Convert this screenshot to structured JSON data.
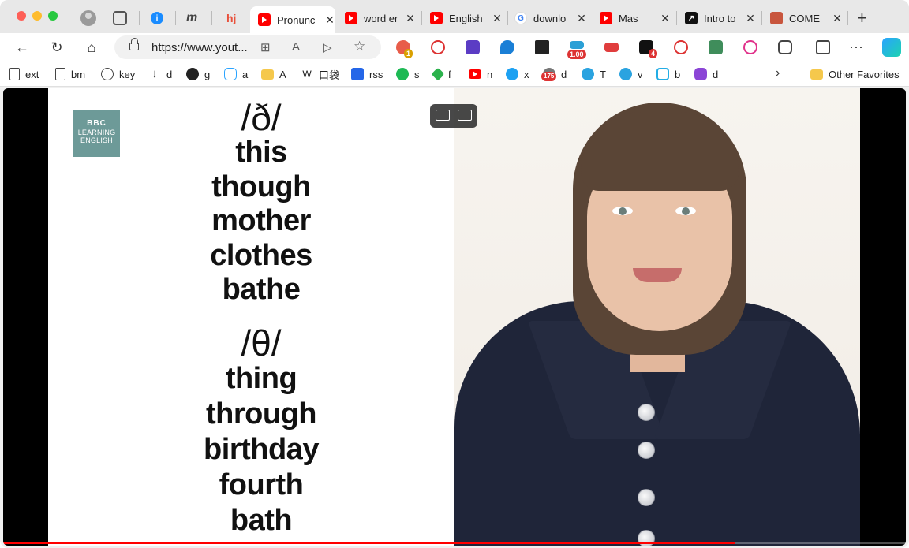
{
  "tabs": [
    {
      "title": "Pronunc",
      "icon": "youtube-icon",
      "active": true
    },
    {
      "title": "word er",
      "icon": "youtube-icon"
    },
    {
      "title": "English",
      "icon": "youtube-icon"
    },
    {
      "title": "downlo",
      "icon": "google-icon"
    },
    {
      "title": "Mas",
      "icon": "youtube-icon"
    },
    {
      "title": "Intro to",
      "icon": "arrow-icon"
    },
    {
      "title": "COME",
      "icon": "crest-icon"
    }
  ],
  "pinned_tabs": [
    "1password-icon",
    "m-icon",
    "hj-icon"
  ],
  "address": {
    "url": "https://www.yout..."
  },
  "extensions": {
    "badges": [
      "1",
      "1.00",
      "4"
    ]
  },
  "bookmarks": [
    {
      "label": "ext",
      "icon": "page-icon"
    },
    {
      "label": "bm",
      "icon": "page-icon"
    },
    {
      "label": "key",
      "icon": "gear-icon"
    },
    {
      "label": "d",
      "icon": "download-icon"
    },
    {
      "label": "g",
      "icon": "github-icon"
    },
    {
      "label": "a",
      "icon": "puzzle-icon"
    },
    {
      "label": "A",
      "icon": "folder-icon"
    },
    {
      "label": "口袋",
      "icon": "letter-icon"
    },
    {
      "label": "rss",
      "icon": "rss-icon"
    },
    {
      "label": "s",
      "icon": "spotify-icon"
    },
    {
      "label": "f",
      "icon": "feedly-icon"
    },
    {
      "label": "n",
      "icon": "youtube-icon"
    },
    {
      "label": "x",
      "icon": "twitter-icon"
    },
    {
      "label": "d",
      "icon": "counter-icon",
      "badge": "175"
    },
    {
      "label": "T",
      "icon": "telegram-icon"
    },
    {
      "label": "v",
      "icon": "search-icon"
    },
    {
      "label": "b",
      "icon": "bilibili-icon"
    },
    {
      "label": "d",
      "icon": "loop-icon"
    }
  ],
  "other_favorites": "Other Favorites",
  "video": {
    "logo": {
      "line1": "BBC",
      "line2": "LEARNING",
      "line3": "ENGLISH"
    },
    "group1": {
      "ipa": "/ð/",
      "words": [
        "this",
        "though",
        "mother",
        "clothes",
        "bathe"
      ]
    },
    "group2": {
      "ipa": "/θ/",
      "words": [
        "thing",
        "through",
        "birthday",
        "fourth",
        "bath"
      ]
    },
    "progress_fraction": 0.81
  },
  "colors": {
    "youtube_red": "#ff0000",
    "logo_teal": "#6d9a98",
    "shirt_navy": "#1f2539"
  }
}
